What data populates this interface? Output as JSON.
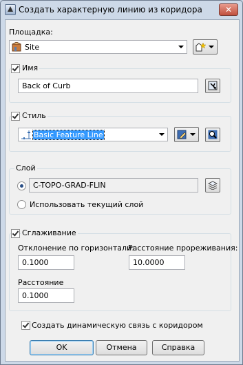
{
  "window": {
    "title": "Создать характерную линию из коридора",
    "close": "✕"
  },
  "site": {
    "label": "Площадка:",
    "value": "Site"
  },
  "name": {
    "label": "Имя",
    "value": "Back of Curb",
    "checked": true
  },
  "style": {
    "label": "Стиль",
    "value": "Basic Feature Line",
    "checked": true
  },
  "layer": {
    "label": "Слой",
    "options": [
      {
        "value": "C-TOPO-GRAD-FLIN",
        "selected": true
      },
      {
        "label": "Использовать текущий слой",
        "selected": false
      }
    ]
  },
  "smoothing": {
    "label": "Сглаживание",
    "checked": true,
    "horizontal_deviation": {
      "label": "Отклонение по горизонтали:",
      "value": "0.1000"
    },
    "weeding_distance": {
      "label": "Расстояние прореживания:",
      "value": "10.0000"
    },
    "distance": {
      "label": "Расстояние",
      "value": "0.1000"
    }
  },
  "dynamic_link": {
    "label": "Создать динамическую связь с коридором",
    "checked": true
  },
  "buttons": {
    "ok": "OK",
    "cancel": "Отмена",
    "help": "Справка"
  }
}
